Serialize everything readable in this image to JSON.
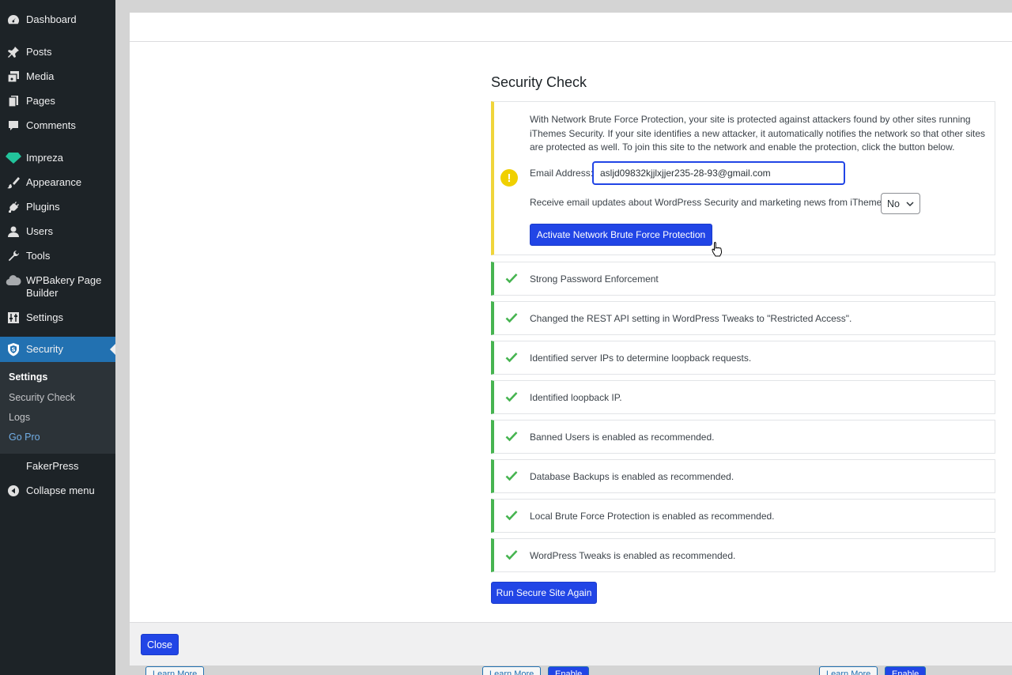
{
  "sidebar": {
    "items": [
      {
        "label": "Dashboard",
        "icon": "dashboard-icon"
      },
      {
        "label": "Posts",
        "icon": "pin-icon"
      },
      {
        "label": "Media",
        "icon": "media-icon"
      },
      {
        "label": "Pages",
        "icon": "pages-icon"
      },
      {
        "label": "Comments",
        "icon": "comment-icon"
      },
      {
        "label": "Impreza",
        "icon": "diamond-icon"
      },
      {
        "label": "Appearance",
        "icon": "brush-icon"
      },
      {
        "label": "Plugins",
        "icon": "plug-icon"
      },
      {
        "label": "Users",
        "icon": "user-icon"
      },
      {
        "label": "Tools",
        "icon": "wrench-icon"
      },
      {
        "label": "WPBakery Page Builder",
        "icon": "cloud-icon"
      },
      {
        "label": "Settings",
        "icon": "sliders-icon"
      },
      {
        "label": "Security",
        "icon": "shield-icon"
      },
      {
        "label": "FakerPress",
        "icon": "fakerpress-icon"
      },
      {
        "label": "Collapse menu",
        "icon": "collapse-icon"
      }
    ],
    "submenu": [
      "Settings",
      "Security Check",
      "Logs",
      "Go Pro"
    ]
  },
  "background_page": {
    "buttons": [
      "Learn More",
      "Enable",
      "Learn More",
      "Enable"
    ]
  },
  "modal": {
    "title": "Security Check",
    "notice": {
      "text": "With Network Brute Force Protection, your site is protected against attackers found by other sites running iThemes Security. If your site identifies a new attacker, it automatically notifies the network so that other sites are protected as well. To join this site to the network and enable the protection, click the button below.",
      "email_label": "Email Address:",
      "email_value": "asljd09832kjjlxjjer235-28-93@gmail.com",
      "updates_label": "Receive email updates about WordPress Security and marketing news from iThemes:",
      "updates_value": "No",
      "activate_label": "Activate Network Brute Force Protection"
    },
    "results": [
      "Strong Password Enforcement",
      "Changed the REST API setting in WordPress Tweaks to \"Restricted Access\".",
      "Identified server IPs to determine loopback requests.",
      "Identified loopback IP.",
      "Banned Users is enabled as recommended.",
      "Database Backups is enabled as recommended.",
      "Local Brute Force Protection is enabled as recommended.",
      "WordPress Tweaks is enabled as recommended."
    ],
    "run_again_label": "Run Secure Site Again",
    "close_label": "Close"
  },
  "colors": {
    "primary_button": "#2145e6",
    "sidebar_bg": "#1d2327",
    "active_menu": "#2271b1",
    "warning_border": "#f0d53a",
    "success_border": "#46b450"
  }
}
